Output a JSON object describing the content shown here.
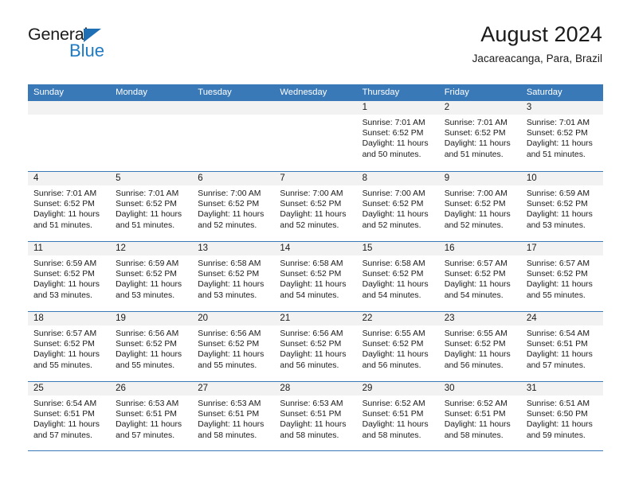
{
  "logo": {
    "word_one": "General",
    "word_two": "Blue",
    "triangle_icon": "triangle-icon",
    "brand_blue": "#1f7ac4",
    "brand_dark": "#1c1c1c"
  },
  "header": {
    "title": "August 2024",
    "subtitle": "Jacareacanga, Para, Brazil"
  },
  "theme": {
    "header_blue": "#3a79b8",
    "daynum_band": "#f2f2f2",
    "text": "#1a1a1a",
    "page_background": "#ffffff"
  },
  "weekday_headers": [
    "Sunday",
    "Monday",
    "Tuesday",
    "Wednesday",
    "Thursday",
    "Friday",
    "Saturday"
  ],
  "weeks": [
    [
      {
        "date": "",
        "empty": true,
        "sunrise": "",
        "sunset": "",
        "daylight_line1": "",
        "daylight_line2": ""
      },
      {
        "date": "",
        "empty": true,
        "sunrise": "",
        "sunset": "",
        "daylight_line1": "",
        "daylight_line2": ""
      },
      {
        "date": "",
        "empty": true,
        "sunrise": "",
        "sunset": "",
        "daylight_line1": "",
        "daylight_line2": ""
      },
      {
        "date": "",
        "empty": true,
        "sunrise": "",
        "sunset": "",
        "daylight_line1": "",
        "daylight_line2": ""
      },
      {
        "date": "1",
        "empty": false,
        "sunrise": "Sunrise: 7:01 AM",
        "sunset": "Sunset: 6:52 PM",
        "daylight_line1": "Daylight: 11 hours",
        "daylight_line2": "and 50 minutes."
      },
      {
        "date": "2",
        "empty": false,
        "sunrise": "Sunrise: 7:01 AM",
        "sunset": "Sunset: 6:52 PM",
        "daylight_line1": "Daylight: 11 hours",
        "daylight_line2": "and 51 minutes."
      },
      {
        "date": "3",
        "empty": false,
        "sunrise": "Sunrise: 7:01 AM",
        "sunset": "Sunset: 6:52 PM",
        "daylight_line1": "Daylight: 11 hours",
        "daylight_line2": "and 51 minutes."
      }
    ],
    [
      {
        "date": "4",
        "empty": false,
        "sunrise": "Sunrise: 7:01 AM",
        "sunset": "Sunset: 6:52 PM",
        "daylight_line1": "Daylight: 11 hours",
        "daylight_line2": "and 51 minutes."
      },
      {
        "date": "5",
        "empty": false,
        "sunrise": "Sunrise: 7:01 AM",
        "sunset": "Sunset: 6:52 PM",
        "daylight_line1": "Daylight: 11 hours",
        "daylight_line2": "and 51 minutes."
      },
      {
        "date": "6",
        "empty": false,
        "sunrise": "Sunrise: 7:00 AM",
        "sunset": "Sunset: 6:52 PM",
        "daylight_line1": "Daylight: 11 hours",
        "daylight_line2": "and 52 minutes."
      },
      {
        "date": "7",
        "empty": false,
        "sunrise": "Sunrise: 7:00 AM",
        "sunset": "Sunset: 6:52 PM",
        "daylight_line1": "Daylight: 11 hours",
        "daylight_line2": "and 52 minutes."
      },
      {
        "date": "8",
        "empty": false,
        "sunrise": "Sunrise: 7:00 AM",
        "sunset": "Sunset: 6:52 PM",
        "daylight_line1": "Daylight: 11 hours",
        "daylight_line2": "and 52 minutes."
      },
      {
        "date": "9",
        "empty": false,
        "sunrise": "Sunrise: 7:00 AM",
        "sunset": "Sunset: 6:52 PM",
        "daylight_line1": "Daylight: 11 hours",
        "daylight_line2": "and 52 minutes."
      },
      {
        "date": "10",
        "empty": false,
        "sunrise": "Sunrise: 6:59 AM",
        "sunset": "Sunset: 6:52 PM",
        "daylight_line1": "Daylight: 11 hours",
        "daylight_line2": "and 53 minutes."
      }
    ],
    [
      {
        "date": "11",
        "empty": false,
        "sunrise": "Sunrise: 6:59 AM",
        "sunset": "Sunset: 6:52 PM",
        "daylight_line1": "Daylight: 11 hours",
        "daylight_line2": "and 53 minutes."
      },
      {
        "date": "12",
        "empty": false,
        "sunrise": "Sunrise: 6:59 AM",
        "sunset": "Sunset: 6:52 PM",
        "daylight_line1": "Daylight: 11 hours",
        "daylight_line2": "and 53 minutes."
      },
      {
        "date": "13",
        "empty": false,
        "sunrise": "Sunrise: 6:58 AM",
        "sunset": "Sunset: 6:52 PM",
        "daylight_line1": "Daylight: 11 hours",
        "daylight_line2": "and 53 minutes."
      },
      {
        "date": "14",
        "empty": false,
        "sunrise": "Sunrise: 6:58 AM",
        "sunset": "Sunset: 6:52 PM",
        "daylight_line1": "Daylight: 11 hours",
        "daylight_line2": "and 54 minutes."
      },
      {
        "date": "15",
        "empty": false,
        "sunrise": "Sunrise: 6:58 AM",
        "sunset": "Sunset: 6:52 PM",
        "daylight_line1": "Daylight: 11 hours",
        "daylight_line2": "and 54 minutes."
      },
      {
        "date": "16",
        "empty": false,
        "sunrise": "Sunrise: 6:57 AM",
        "sunset": "Sunset: 6:52 PM",
        "daylight_line1": "Daylight: 11 hours",
        "daylight_line2": "and 54 minutes."
      },
      {
        "date": "17",
        "empty": false,
        "sunrise": "Sunrise: 6:57 AM",
        "sunset": "Sunset: 6:52 PM",
        "daylight_line1": "Daylight: 11 hours",
        "daylight_line2": "and 55 minutes."
      }
    ],
    [
      {
        "date": "18",
        "empty": false,
        "sunrise": "Sunrise: 6:57 AM",
        "sunset": "Sunset: 6:52 PM",
        "daylight_line1": "Daylight: 11 hours",
        "daylight_line2": "and 55 minutes."
      },
      {
        "date": "19",
        "empty": false,
        "sunrise": "Sunrise: 6:56 AM",
        "sunset": "Sunset: 6:52 PM",
        "daylight_line1": "Daylight: 11 hours",
        "daylight_line2": "and 55 minutes."
      },
      {
        "date": "20",
        "empty": false,
        "sunrise": "Sunrise: 6:56 AM",
        "sunset": "Sunset: 6:52 PM",
        "daylight_line1": "Daylight: 11 hours",
        "daylight_line2": "and 55 minutes."
      },
      {
        "date": "21",
        "empty": false,
        "sunrise": "Sunrise: 6:56 AM",
        "sunset": "Sunset: 6:52 PM",
        "daylight_line1": "Daylight: 11 hours",
        "daylight_line2": "and 56 minutes."
      },
      {
        "date": "22",
        "empty": false,
        "sunrise": "Sunrise: 6:55 AM",
        "sunset": "Sunset: 6:52 PM",
        "daylight_line1": "Daylight: 11 hours",
        "daylight_line2": "and 56 minutes."
      },
      {
        "date": "23",
        "empty": false,
        "sunrise": "Sunrise: 6:55 AM",
        "sunset": "Sunset: 6:52 PM",
        "daylight_line1": "Daylight: 11 hours",
        "daylight_line2": "and 56 minutes."
      },
      {
        "date": "24",
        "empty": false,
        "sunrise": "Sunrise: 6:54 AM",
        "sunset": "Sunset: 6:51 PM",
        "daylight_line1": "Daylight: 11 hours",
        "daylight_line2": "and 57 minutes."
      }
    ],
    [
      {
        "date": "25",
        "empty": false,
        "sunrise": "Sunrise: 6:54 AM",
        "sunset": "Sunset: 6:51 PM",
        "daylight_line1": "Daylight: 11 hours",
        "daylight_line2": "and 57 minutes."
      },
      {
        "date": "26",
        "empty": false,
        "sunrise": "Sunrise: 6:53 AM",
        "sunset": "Sunset: 6:51 PM",
        "daylight_line1": "Daylight: 11 hours",
        "daylight_line2": "and 57 minutes."
      },
      {
        "date": "27",
        "empty": false,
        "sunrise": "Sunrise: 6:53 AM",
        "sunset": "Sunset: 6:51 PM",
        "daylight_line1": "Daylight: 11 hours",
        "daylight_line2": "and 58 minutes."
      },
      {
        "date": "28",
        "empty": false,
        "sunrise": "Sunrise: 6:53 AM",
        "sunset": "Sunset: 6:51 PM",
        "daylight_line1": "Daylight: 11 hours",
        "daylight_line2": "and 58 minutes."
      },
      {
        "date": "29",
        "empty": false,
        "sunrise": "Sunrise: 6:52 AM",
        "sunset": "Sunset: 6:51 PM",
        "daylight_line1": "Daylight: 11 hours",
        "daylight_line2": "and 58 minutes."
      },
      {
        "date": "30",
        "empty": false,
        "sunrise": "Sunrise: 6:52 AM",
        "sunset": "Sunset: 6:51 PM",
        "daylight_line1": "Daylight: 11 hours",
        "daylight_line2": "and 58 minutes."
      },
      {
        "date": "31",
        "empty": false,
        "sunrise": "Sunrise: 6:51 AM",
        "sunset": "Sunset: 6:50 PM",
        "daylight_line1": "Daylight: 11 hours",
        "daylight_line2": "and 59 minutes."
      }
    ]
  ]
}
